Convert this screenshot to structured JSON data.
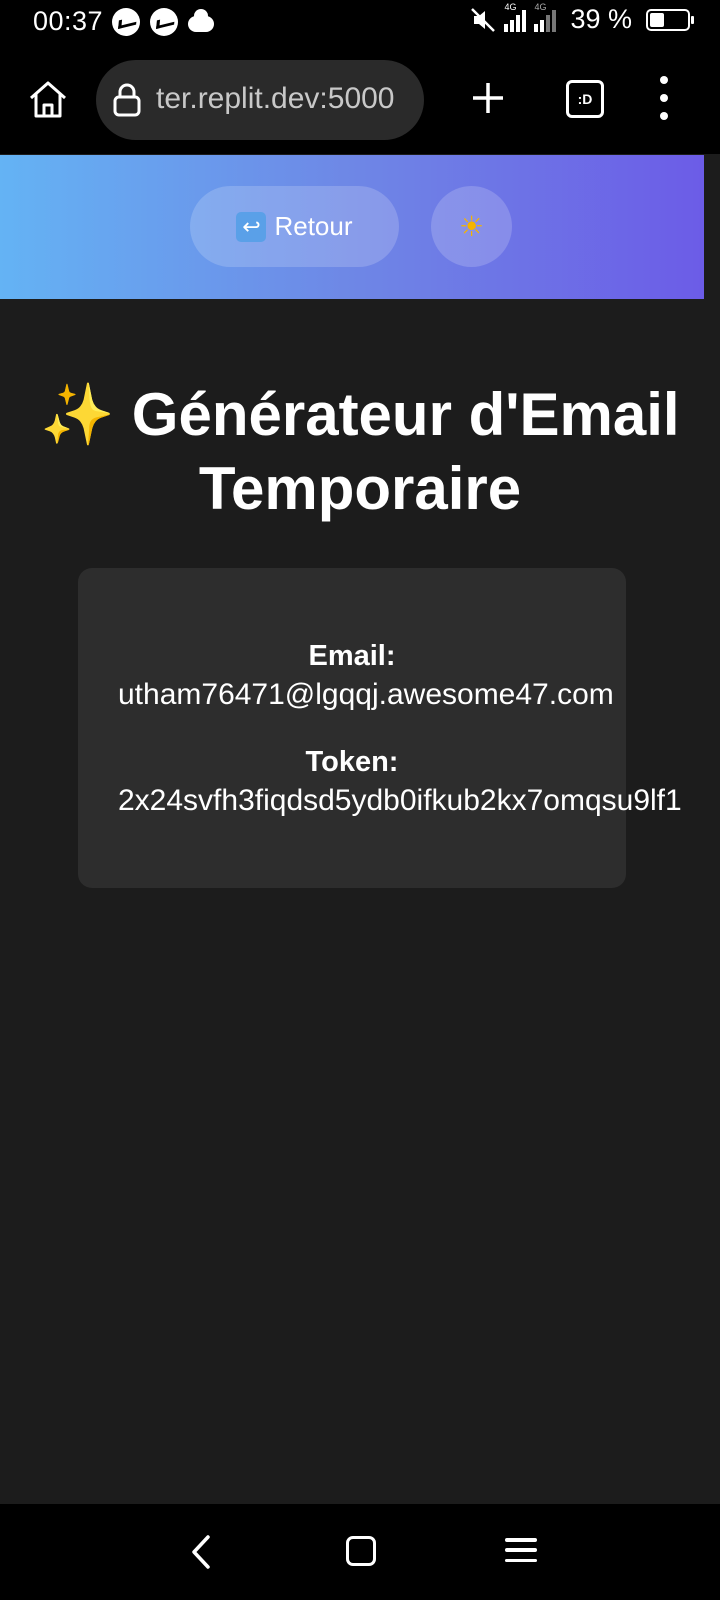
{
  "status_bar": {
    "time": "00:37",
    "network_tag_1": "4G",
    "network_tag_2": "4G",
    "battery_percent": "39 %",
    "battery_level": 0.39
  },
  "browser": {
    "url": "ter.replit.dev:5000",
    "tabs_label": ":D"
  },
  "header": {
    "back_icon": "↩",
    "back_label": "Retour",
    "theme_icon": "☀"
  },
  "main": {
    "title_emoji": "✨",
    "title": "Générateur d'Email Temporaire",
    "email_label": "Email:",
    "email_value": "utham76471@lgqqj.awesome47.com",
    "token_label": "Token:",
    "token_value": "2x24svfh3fiqdsd5ydb0ifkub2kx7omqsu9lf1"
  },
  "colors": {
    "header_gradient_start": "#64b3f4",
    "header_gradient_end": "#6c5ce7",
    "page_background": "#1c1c1c",
    "card_background": "#2d2d2d"
  }
}
